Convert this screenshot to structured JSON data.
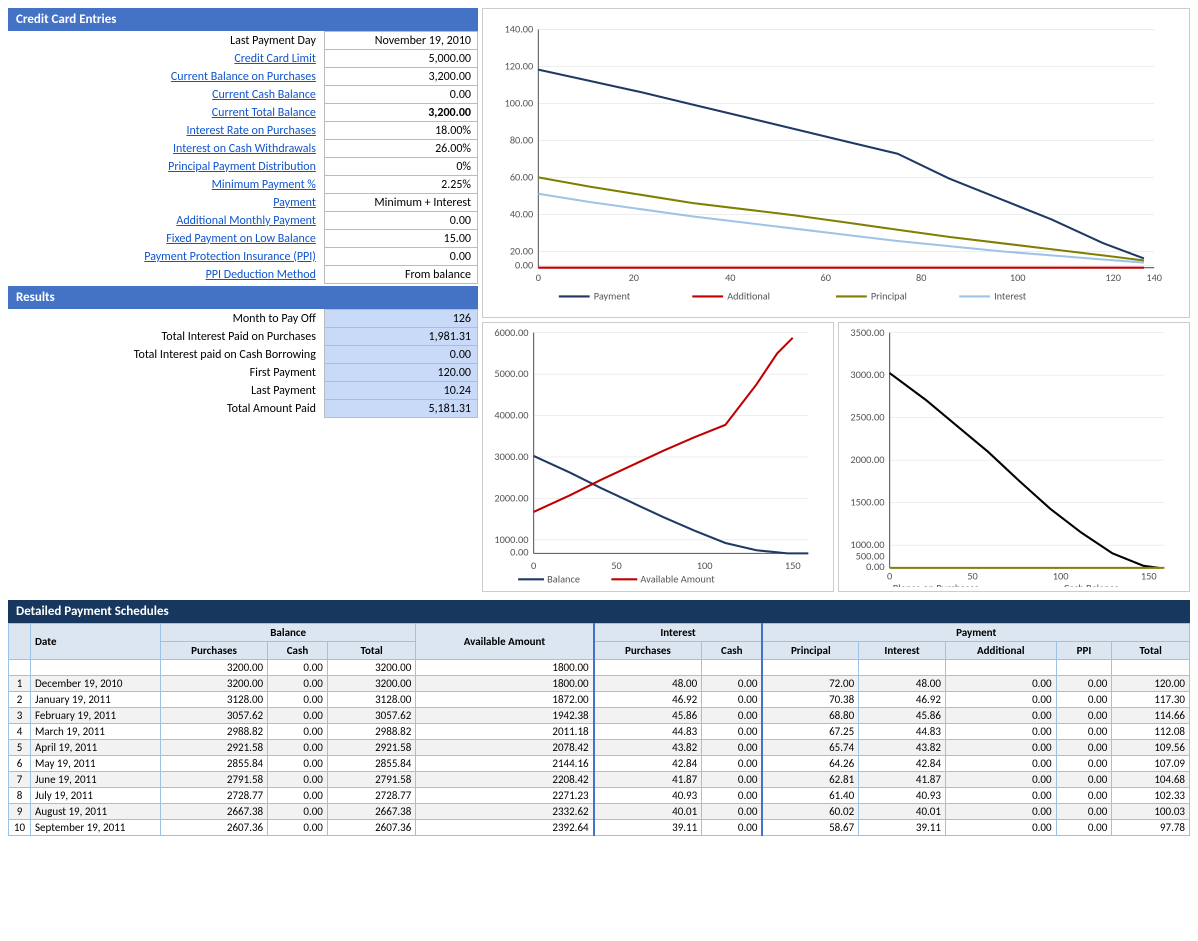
{
  "creditCardEntries": {
    "title": "Credit Card Entries",
    "fields": [
      {
        "label": "Last Payment Day",
        "value": "November 19, 2010",
        "isLink": false,
        "bold": false
      },
      {
        "label": "Credit Card Limit",
        "value": "5,000.00",
        "isLink": true,
        "bold": false
      },
      {
        "label": "Current Balance on Purchases",
        "value": "3,200.00",
        "isLink": true,
        "bold": false
      },
      {
        "label": "Current Cash Balance",
        "value": "0.00",
        "isLink": true,
        "bold": false
      },
      {
        "label": "Current Total Balance",
        "value": "3,200.00",
        "isLink": true,
        "bold": true
      },
      {
        "label": "Interest Rate on Purchases",
        "value": "18.00%",
        "isLink": true,
        "bold": false
      },
      {
        "label": "Interest on Cash Withdrawals",
        "value": "26.00%",
        "isLink": true,
        "bold": false
      },
      {
        "label": "Principal Payment Distribution",
        "value": "0%",
        "isLink": true,
        "bold": false
      },
      {
        "label": "Minimum Payment %",
        "value": "2.25%",
        "isLink": true,
        "bold": false
      },
      {
        "label": "Payment",
        "value": "Minimum + Interest",
        "isLink": true,
        "bold": false
      },
      {
        "label": "Additional Monthly Payment",
        "value": "0.00",
        "isLink": true,
        "bold": false
      },
      {
        "label": "Fixed Payment on Low Balance",
        "value": "15.00",
        "isLink": true,
        "bold": false
      },
      {
        "label": "Payment Protection Insurance (PPI)",
        "value": "0.00",
        "isLink": true,
        "bold": false
      },
      {
        "label": "PPI Deduction Method",
        "value": "From balance",
        "isLink": true,
        "bold": false
      }
    ]
  },
  "results": {
    "title": "Results",
    "fields": [
      {
        "label": "Month to Pay Off",
        "value": "126"
      },
      {
        "label": "Total Interest Paid on Purchases",
        "value": "1,981.31"
      },
      {
        "label": "Total Interest paid on Cash Borrowing",
        "value": "0.00"
      },
      {
        "label": "First Payment",
        "value": "120.00"
      },
      {
        "label": "Last Payment",
        "value": "10.24"
      },
      {
        "label": "Total Amount Paid",
        "value": "5,181.31"
      }
    ]
  },
  "detailTable": {
    "title": "Detailed Payment Schedules",
    "headers": {
      "date": "Date",
      "balanceGroup": "Balance",
      "balancePurchases": "Purchases",
      "balanceCash": "Cash",
      "balanceTotal": "Total",
      "available": "Available Amount",
      "interestGroup": "Interest",
      "interestPurchases": "Purchases",
      "interestCash": "Cash",
      "paymentGroup": "Payment",
      "paymentPrincipal": "Principal",
      "paymentInterest": "Interest",
      "paymentAdditional": "Additional",
      "paymentPPI": "PPI",
      "paymentTotal": "Total"
    },
    "initRow": {
      "purchases": "3200.00",
      "cash": "0.00",
      "total": "3200.00",
      "available": "1800.00"
    },
    "rows": [
      {
        "num": 1,
        "date": "December 19, 2010",
        "purBalance": "3200.00",
        "cashBalance": "0.00",
        "totalBalance": "3200.00",
        "available": "1800.00",
        "iPurchases": "48.00",
        "iCash": "0.00",
        "pPrincipal": "72.00",
        "pInterest": "48.00",
        "pAdditional": "0.00",
        "pPPI": "0.00",
        "pTotal": "120.00"
      },
      {
        "num": 2,
        "date": "January 19, 2011",
        "purBalance": "3128.00",
        "cashBalance": "0.00",
        "totalBalance": "3128.00",
        "available": "1872.00",
        "iPurchases": "46.92",
        "iCash": "0.00",
        "pPrincipal": "70.38",
        "pInterest": "46.92",
        "pAdditional": "0.00",
        "pPPI": "0.00",
        "pTotal": "117.30"
      },
      {
        "num": 3,
        "date": "February 19, 2011",
        "purBalance": "3057.62",
        "cashBalance": "0.00",
        "totalBalance": "3057.62",
        "available": "1942.38",
        "iPurchases": "45.86",
        "iCash": "0.00",
        "pPrincipal": "68.80",
        "pInterest": "45.86",
        "pAdditional": "0.00",
        "pPPI": "0.00",
        "pTotal": "114.66"
      },
      {
        "num": 4,
        "date": "March 19, 2011",
        "purBalance": "2988.82",
        "cashBalance": "0.00",
        "totalBalance": "2988.82",
        "available": "2011.18",
        "iPurchases": "44.83",
        "iCash": "0.00",
        "pPrincipal": "67.25",
        "pInterest": "44.83",
        "pAdditional": "0.00",
        "pPPI": "0.00",
        "pTotal": "112.08"
      },
      {
        "num": 5,
        "date": "April 19, 2011",
        "purBalance": "2921.58",
        "cashBalance": "0.00",
        "totalBalance": "2921.58",
        "available": "2078.42",
        "iPurchases": "43.82",
        "iCash": "0.00",
        "pPrincipal": "65.74",
        "pInterest": "43.82",
        "pAdditional": "0.00",
        "pPPI": "0.00",
        "pTotal": "109.56"
      },
      {
        "num": 6,
        "date": "May 19, 2011",
        "purBalance": "2855.84",
        "cashBalance": "0.00",
        "totalBalance": "2855.84",
        "available": "2144.16",
        "iPurchases": "42.84",
        "iCash": "0.00",
        "pPrincipal": "64.26",
        "pInterest": "42.84",
        "pAdditional": "0.00",
        "pPPI": "0.00",
        "pTotal": "107.09"
      },
      {
        "num": 7,
        "date": "June 19, 2011",
        "purBalance": "2791.58",
        "cashBalance": "0.00",
        "totalBalance": "2791.58",
        "available": "2208.42",
        "iPurchases": "41.87",
        "iCash": "0.00",
        "pPrincipal": "62.81",
        "pInterest": "41.87",
        "pAdditional": "0.00",
        "pPPI": "0.00",
        "pTotal": "104.68"
      },
      {
        "num": 8,
        "date": "July 19, 2011",
        "purBalance": "2728.77",
        "cashBalance": "0.00",
        "totalBalance": "2728.77",
        "available": "2271.23",
        "iPurchases": "40.93",
        "iCash": "0.00",
        "pPrincipal": "61.40",
        "pInterest": "40.93",
        "pAdditional": "0.00",
        "pPPI": "0.00",
        "pTotal": "102.33"
      },
      {
        "num": 9,
        "date": "August 19, 2011",
        "purBalance": "2667.38",
        "cashBalance": "0.00",
        "totalBalance": "2667.38",
        "available": "2332.62",
        "iPurchases": "40.01",
        "iCash": "0.00",
        "pPrincipal": "60.02",
        "pInterest": "40.01",
        "pAdditional": "0.00",
        "pPPI": "0.00",
        "pTotal": "100.03"
      },
      {
        "num": 10,
        "date": "September 19, 2011",
        "purBalance": "2607.36",
        "cashBalance": "0.00",
        "totalBalance": "2607.36",
        "available": "2392.64",
        "iPurchases": "39.11",
        "iCash": "0.00",
        "pPrincipal": "58.67",
        "pInterest": "39.11",
        "pAdditional": "0.00",
        "pPPI": "0.00",
        "pTotal": "97.78"
      }
    ]
  },
  "charts": {
    "top": {
      "yMax": 140,
      "yMin": 0,
      "xMax": 140,
      "xMin": 0,
      "legend": [
        {
          "label": "Payment",
          "color": "#1f3864"
        },
        {
          "label": "Additional",
          "color": "#c00000"
        },
        {
          "label": "Principal",
          "color": "#7f7f00"
        },
        {
          "label": "Interest",
          "color": "#9dc3e6"
        }
      ]
    },
    "bottomLeft": {
      "yMax": 6000,
      "xMax": 150,
      "legend": [
        {
          "label": "Balance",
          "color": "#1f3864"
        },
        {
          "label": "Available Amount",
          "color": "#c00000"
        }
      ]
    },
    "bottomRight": {
      "yMax": 3500,
      "xMax": 150,
      "legend": [
        {
          "label": "Blance on Purchases",
          "color": "#000"
        },
        {
          "label": "Cash Balance",
          "color": "#7f7f00"
        }
      ]
    }
  }
}
